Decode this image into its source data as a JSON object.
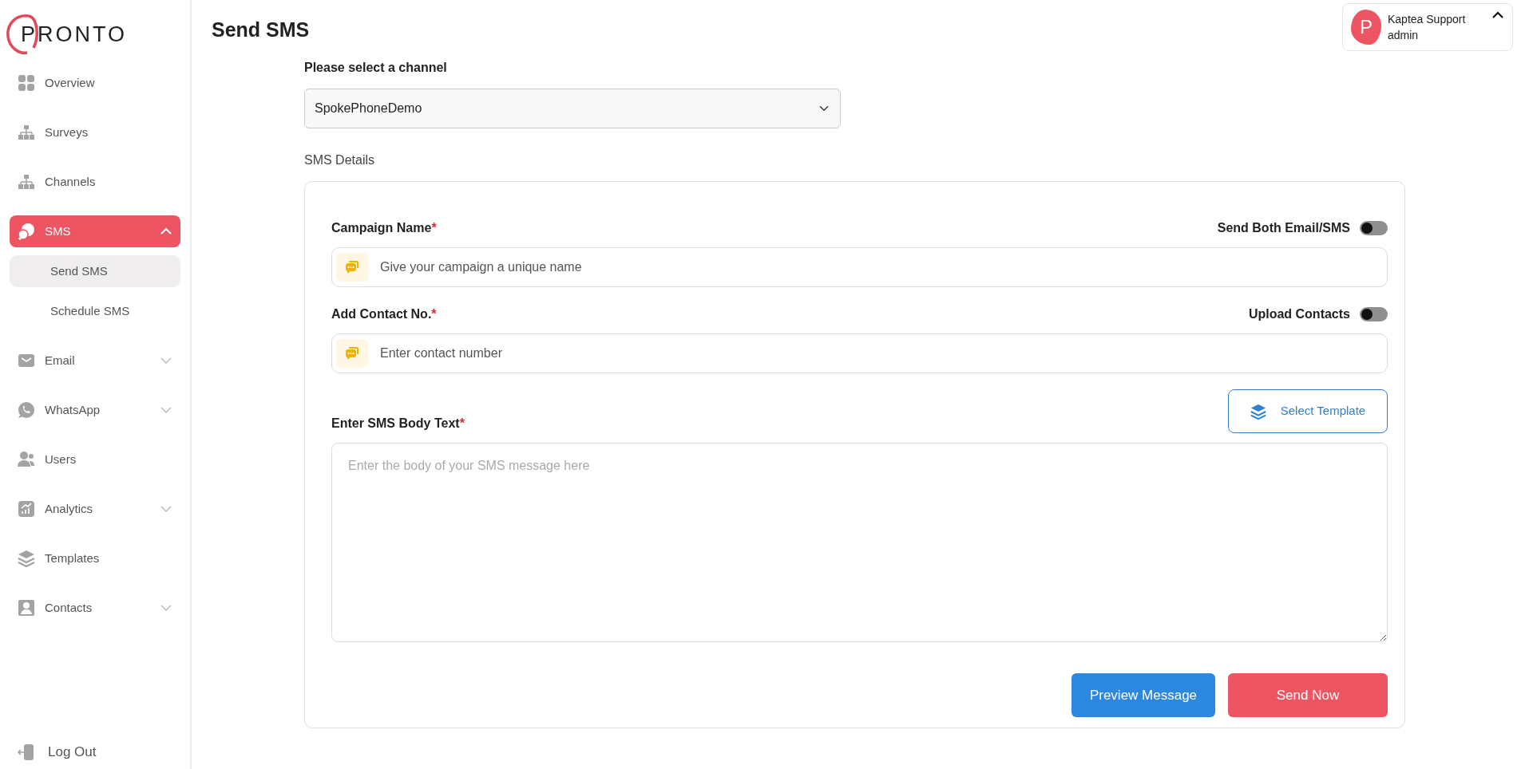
{
  "sidebar": {
    "logo": "PRONTO",
    "items": [
      {
        "label": "Overview",
        "selected": false
      },
      {
        "label": "Surveys",
        "selected": false
      },
      {
        "label": "Channels",
        "selected": false
      },
      {
        "label": "SMS",
        "selected": true,
        "expanded": true,
        "children": [
          {
            "label": "Send SMS",
            "selected": true
          },
          {
            "label": "Schedule SMS",
            "selected": false
          }
        ]
      },
      {
        "label": "Email",
        "selected": false,
        "expanded": false
      },
      {
        "label": "WhatsApp",
        "selected": false,
        "expanded": false
      },
      {
        "label": "Users",
        "selected": false
      },
      {
        "label": "Analytics",
        "selected": false,
        "expanded": false
      },
      {
        "label": "Templates",
        "selected": false
      },
      {
        "label": "Contacts",
        "selected": false,
        "expanded": false
      }
    ],
    "logout": "Log Out"
  },
  "page_title": "Send SMS",
  "user_menu": {
    "avatar_letter": "P",
    "name": "Kaptea Support",
    "role": "admin",
    "expanded": true
  },
  "channel": {
    "label": "Please select a channel",
    "value": "SpokePhoneDemo"
  },
  "section_title": "SMS Details",
  "form": {
    "fields": [
      {
        "label": "Campaign Name",
        "mark": "*",
        "placeholder": "Give your campaign a unique name",
        "toggle": {
          "label": "Send Both Email/SMS",
          "on": false
        }
      },
      {
        "label": "Add Contact No.",
        "mark": "*",
        "placeholder": "Enter contact number",
        "toggle": {
          "label": "Upload Contacts",
          "on": false
        }
      }
    ],
    "template_button": "Select Template",
    "body": {
      "label": "Enter SMS Body Text",
      "mark": "*",
      "placeholder": "Enter the body of your SMS message here"
    },
    "buttons": [
      {
        "label": "Preview Message",
        "kind": "secondary"
      },
      {
        "label": "Send Now",
        "kind": "primary"
      }
    ]
  }
}
